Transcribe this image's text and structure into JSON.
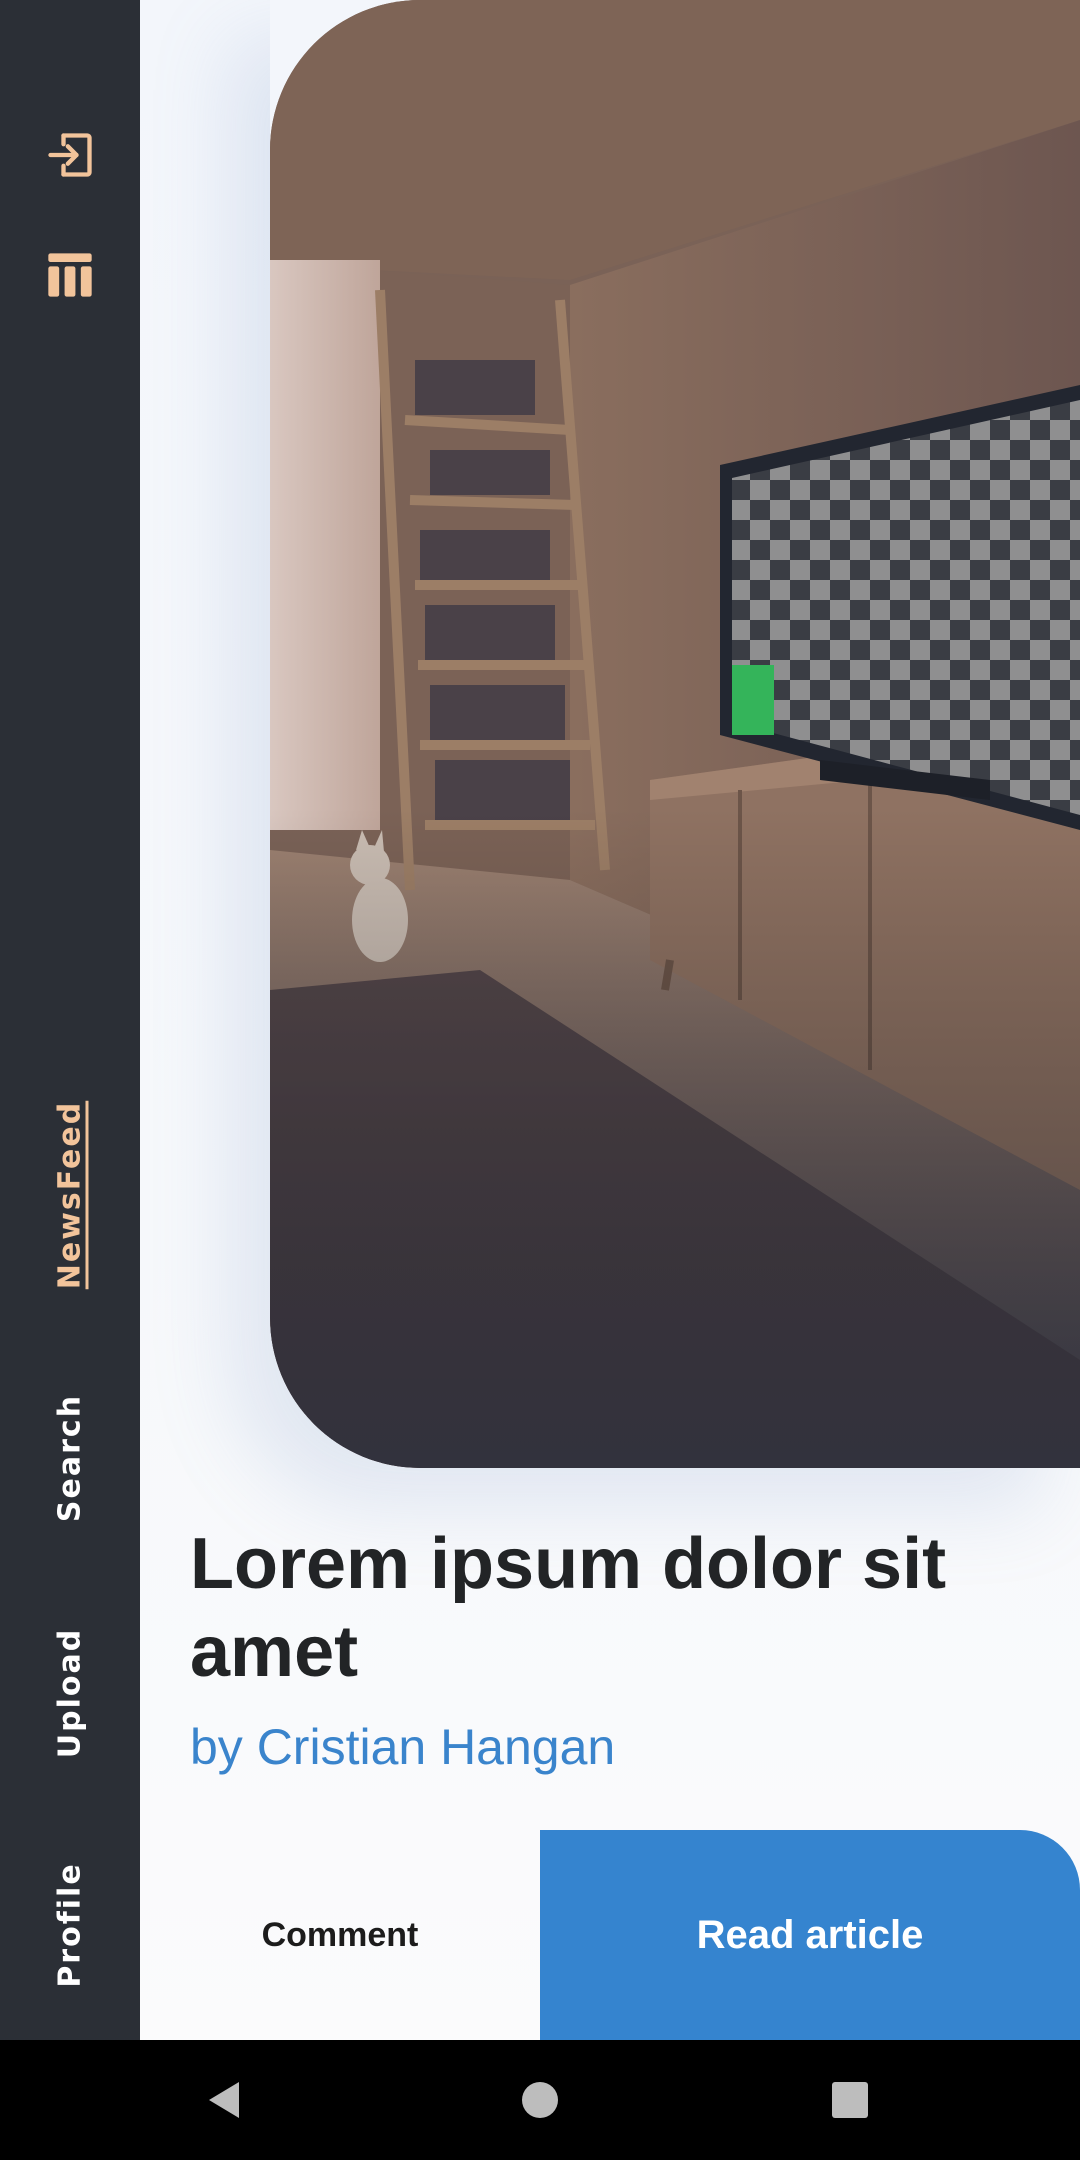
{
  "sidebar": {
    "nav": [
      {
        "label": "NewsFeed",
        "active": true
      },
      {
        "label": "Search",
        "active": false
      },
      {
        "label": "Upload",
        "active": false
      },
      {
        "label": "Profile",
        "active": false
      }
    ],
    "icons": [
      "login-icon",
      "table-icon"
    ]
  },
  "article": {
    "title": "Lorem ipsum dolor sit amet",
    "author": "by Cristian Hangan",
    "image_icon": "room-photo"
  },
  "actions": {
    "comment_label": "Comment",
    "read_label": "Read article"
  },
  "system_nav": [
    "back-icon",
    "home-icon",
    "recents-icon"
  ],
  "colors": {
    "sidebar_bg": "#2b2f36",
    "accent": "#f2c49b",
    "primary": "#3584cf",
    "title": "#222426",
    "author": "#3a84cc"
  }
}
